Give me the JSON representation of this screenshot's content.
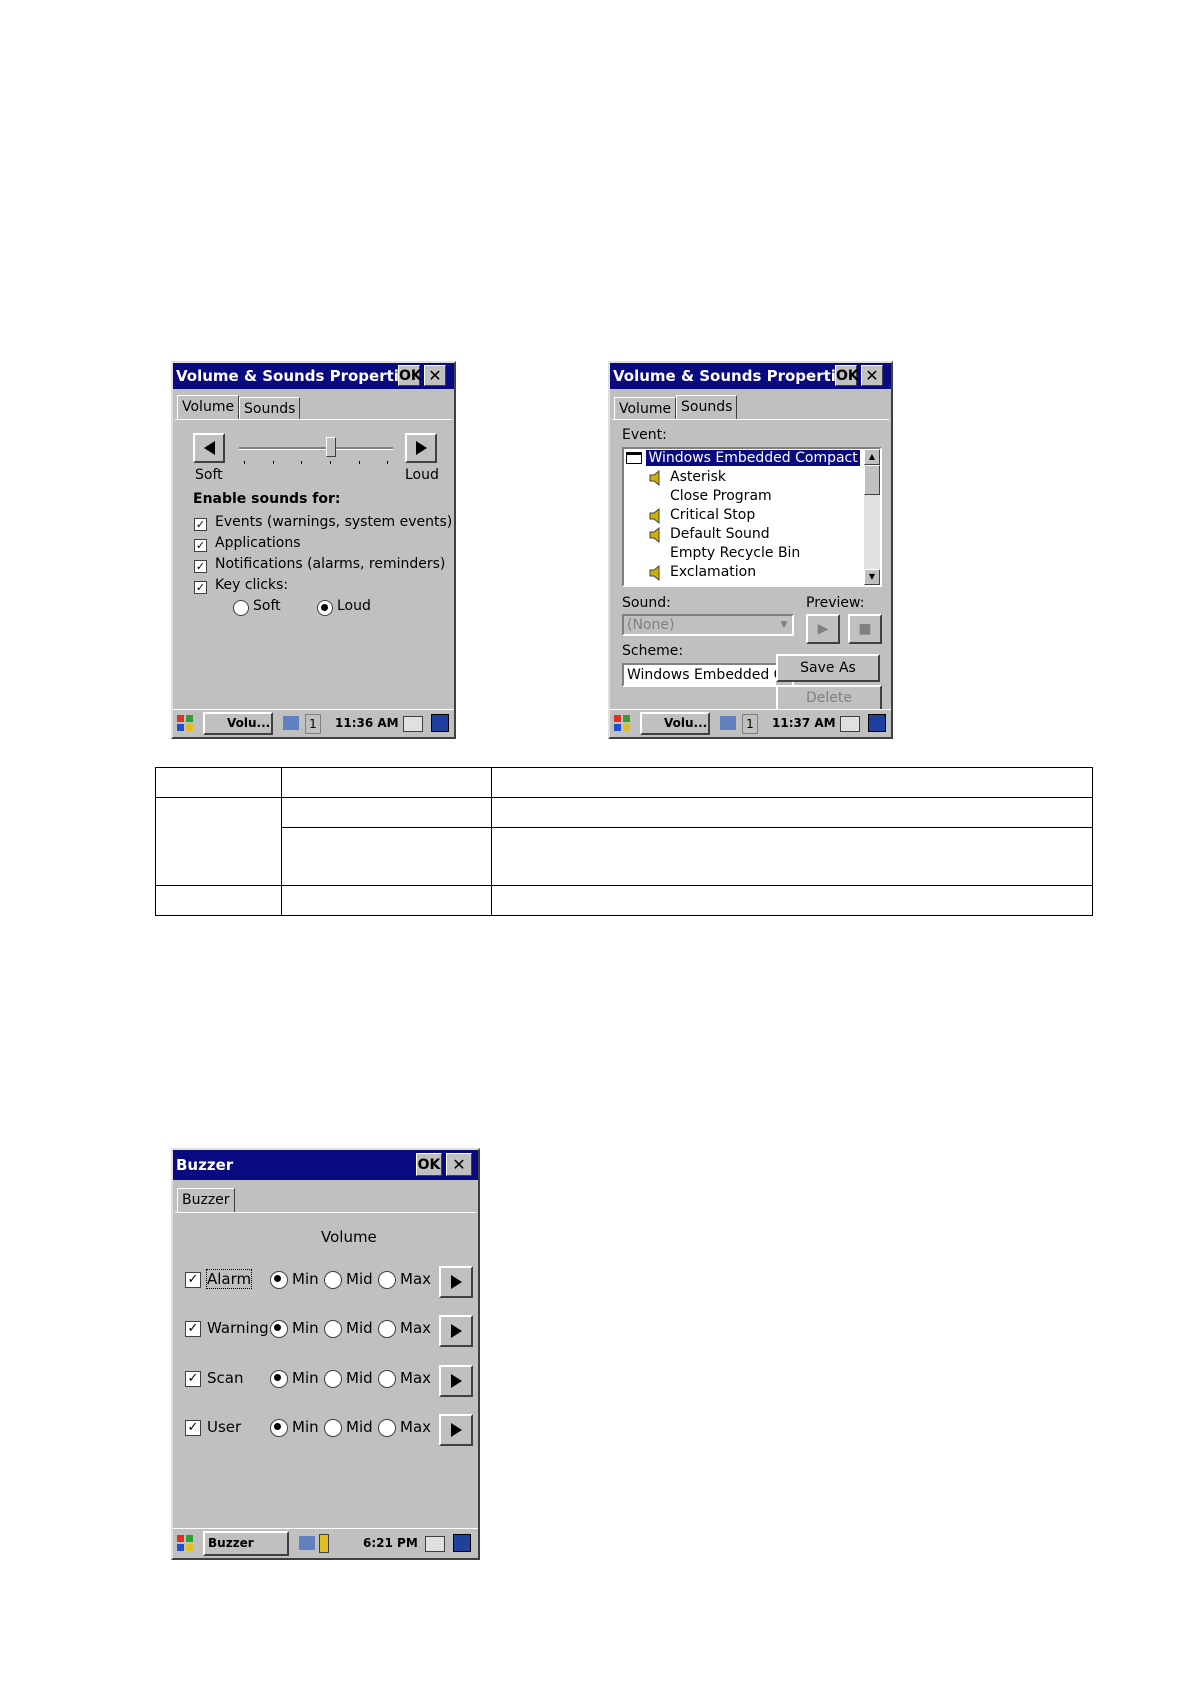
{
  "vol1": {
    "title": "Volume & Sounds Properties",
    "ok": "OK",
    "tabs": [
      "Volume",
      "Sounds"
    ],
    "soft_label": "Soft",
    "loud_label": "Loud",
    "slider_level_fraction": 0.6,
    "enable_heading": "Enable sounds for:",
    "checks": [
      "Events (warnings, system events)",
      "Applications",
      "Notifications (alarms, reminders)",
      "Key clicks:"
    ],
    "radio_soft": "Soft",
    "radio_loud": "Loud",
    "task_label": "Volu...",
    "task_num": "1",
    "time": "11:36 AM"
  },
  "vol2": {
    "title": "Volume & Sounds Properties",
    "ok": "OK",
    "tabs": [
      "Volume",
      "Sounds"
    ],
    "event_label": "Event:",
    "events": [
      "Windows Embedded Compact",
      "Asterisk",
      "Close Program",
      "Critical Stop",
      "Default Sound",
      "Empty Recycle Bin",
      "Exclamation"
    ],
    "sound_label": "Sound:",
    "sound_value": "(None)",
    "preview_label": "Preview:",
    "scheme_label": "Scheme:",
    "scheme_value": "Windows Embedded C",
    "save_as": "Save As",
    "delete": "Delete",
    "task_label": "Volu...",
    "task_num": "1",
    "time": "11:37 AM"
  },
  "buzzer": {
    "title": "Buzzer",
    "ok": "OK",
    "tab": "Buzzer",
    "volume_heading": "Volume",
    "rows": [
      {
        "label": "Alarm"
      },
      {
        "label": "Warning"
      },
      {
        "label": "Scan"
      },
      {
        "label": "User"
      }
    ],
    "min": "Min",
    "mid": "Mid",
    "max": "Max",
    "task_label": "Buzzer",
    "time": "6:21 PM"
  }
}
